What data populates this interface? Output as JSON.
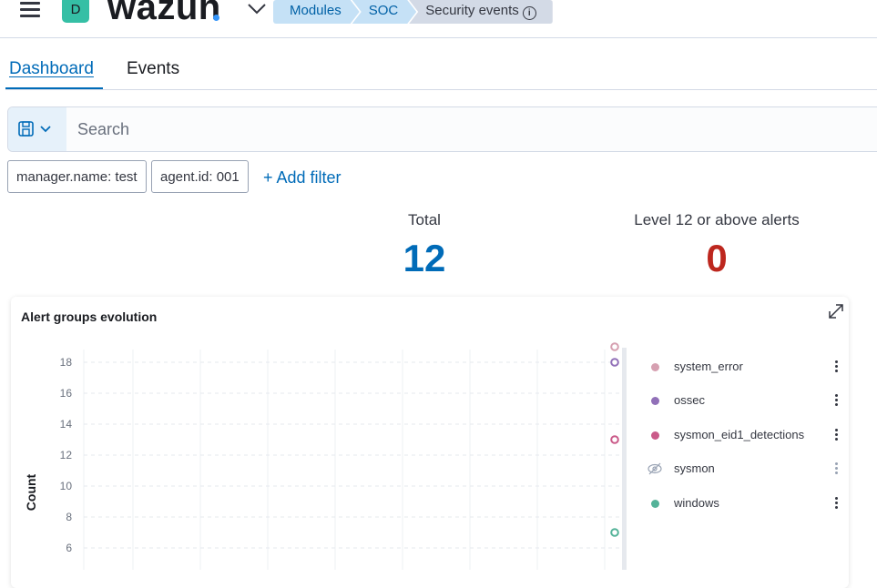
{
  "header": {
    "avatar_letter": "D",
    "logo_text": "wazuh",
    "breadcrumbs": [
      "Modules",
      "SOC",
      "Security events"
    ],
    "info_icon": "info-icon"
  },
  "tabs": [
    "Dashboard",
    "Events"
  ],
  "search": {
    "placeholder": "Search"
  },
  "filters": [
    "manager.name: test",
    "agent.id: 001"
  ],
  "add_filter_label": "+ Add filter",
  "metrics": [
    {
      "title": "Total",
      "value": "12",
      "color": "#006bb8"
    },
    {
      "title": "Level 12 or above alerts",
      "value": "0",
      "color": "#bd271e"
    }
  ],
  "panel": {
    "title": "Alert groups evolution"
  },
  "chart_data": {
    "type": "scatter",
    "title": "Alert groups evolution",
    "ylabel": "Count",
    "y_ticks": [
      6,
      8,
      10,
      12,
      14,
      16,
      18
    ],
    "series": [
      {
        "name": "system_error",
        "color": "#d6a0b1",
        "values": [
          19
        ],
        "hidden": false
      },
      {
        "name": "ossec",
        "color": "#9170b8",
        "values": [
          18
        ],
        "hidden": false
      },
      {
        "name": "sysmon_eid1_detections",
        "color": "#ca5a89",
        "values": [
          13
        ],
        "hidden": false
      },
      {
        "name": "sysmon",
        "color": "#98a2b3",
        "values": [],
        "hidden": true
      },
      {
        "name": "windows",
        "color": "#54b399",
        "values": [
          7
        ],
        "hidden": false
      }
    ]
  }
}
